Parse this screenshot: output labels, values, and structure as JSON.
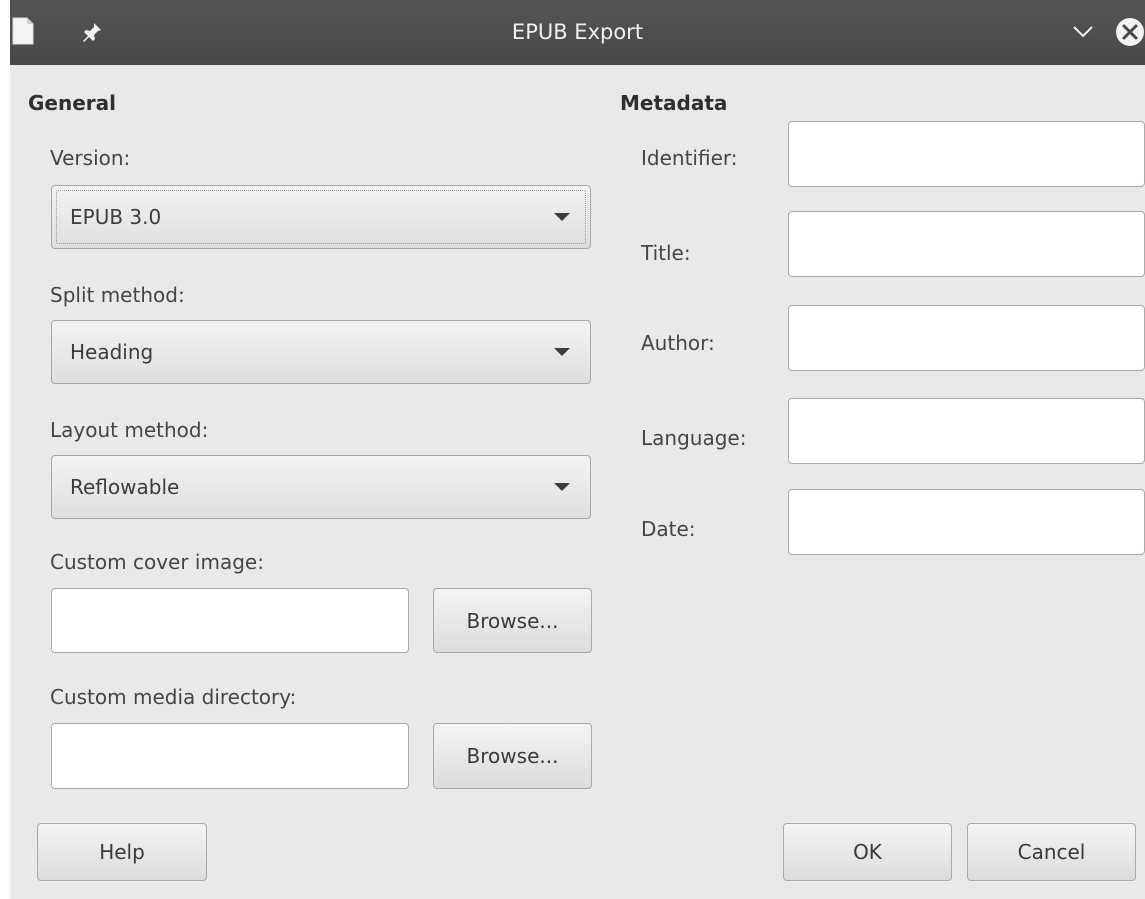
{
  "window": {
    "title": "EPUB Export",
    "icons": [
      "document-icon",
      "pin-icon",
      "chevron-down-icon",
      "close-icon"
    ]
  },
  "general": {
    "heading": "General",
    "version_label": "Version:",
    "version_value": "EPUB 3.0",
    "split_label": "Split method:",
    "split_value": "Heading",
    "layout_label": "Layout method:",
    "layout_value": "Reflowable",
    "cover_label": "Custom cover image:",
    "cover_value": "",
    "cover_browse": "Browse...",
    "media_label": "Custom media directory:",
    "media_value": "",
    "media_browse": "Browse..."
  },
  "metadata": {
    "heading": "Metadata",
    "identifier_label": "Identifier:",
    "identifier_value": "",
    "title_label": "Title:",
    "title_value": "",
    "author_label": "Author:",
    "author_value": "",
    "language_label": "Language:",
    "language_value": "",
    "date_label": "Date:",
    "date_value": ""
  },
  "buttons": {
    "help": "Help",
    "ok": "OK",
    "cancel": "Cancel"
  }
}
